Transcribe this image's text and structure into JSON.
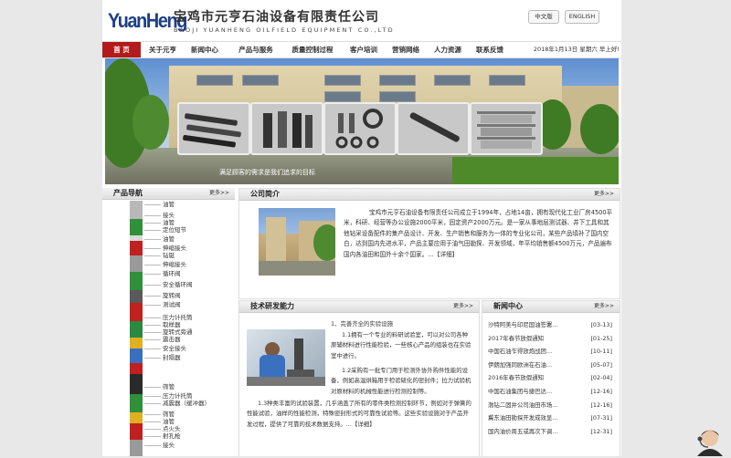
{
  "header": {
    "logo_en": "YuanHeng",
    "company_cn": "宝鸡市元亨石油设备有限责任公司",
    "company_en": "BAOJI YUANHENG OILFIELD EQUIPMENT CO.,LTD",
    "lang_cn": "中文版",
    "lang_en": "ENGLISH"
  },
  "nav": {
    "items": [
      "首 页",
      "关于元亨",
      "新闻中心",
      "产品与服务",
      "质量控制过程",
      "客户培训",
      "营销网络",
      "人力资源",
      "联系反馈"
    ],
    "date": "2018年1月13日 星期六 早上好!"
  },
  "banner": {
    "caption": "满足顾客的需求是我们追求的目标"
  },
  "products": {
    "title": "产品导航",
    "more": "更多>>",
    "items": [
      "油管",
      "接头",
      "油管",
      "定位短节",
      "油管",
      "伸缩接头",
      "钻铤",
      "伸缩接头",
      "循环阀",
      "安全循环阀",
      "旋转阀",
      "测试阀",
      "压力计托筒",
      "取样器",
      "旋转式旁通",
      "震击器",
      "安全接头",
      "封隔器",
      "筛管",
      "压力计托筒",
      "减震器（缓冲器）",
      "筛管",
      "油管",
      "点火头",
      "射孔枪",
      "接头"
    ]
  },
  "company": {
    "title": "公司简介",
    "more": "更多>>",
    "text": "宝鸡市元亨石油设备有限责任公司成立于1994年，占地14亩，拥有现代化工业厂房4500平米，科研、经营等办公设施2000平米，固定资产2000万元。是一家从事地层测试器、井下工具和其他钻采设备配件的集产品设计、开发、生产销售和服务为一体的专业化公司，某些产品填补了国内空白，达到国内先进水平，产品主要应用于油气田勘探、开发领域，年平均销售额4500万元，产品遍布国内各油田和国外十余个国家。…【详细】"
  },
  "tech": {
    "title": "技术研发能力",
    "more": "更多>>",
    "p1": "1、完善齐全的实验设施",
    "p2": "1.1拥有一个专业的料研试验室，可以对公司各种原辅材料进行性能检验，一些核心产品的组装也在实验室中进行。",
    "p3": "1.2采购有一批专门用于检测外协外购件性能的设备，例如高温烘箱用于检验硫化的密封件；拉力试验机对原材料的机械性能进行检测控制等。",
    "p4": "1.3种类丰富的试验装置，几乎涵盖了所有的零件类检测控制环节，例如对于弹簧的性能试验，油样的性能检测，特殊密封形式的可靠性试验等。这些实验设施对于产品开发过程，提供了可靠的技术数据支持。…【详细】"
  },
  "news": {
    "title": "新闻中心",
    "more": "更多>>",
    "items": [
      {
        "title": "沙特阿美与印尼国油签署…",
        "date": "[03-13]"
      },
      {
        "title": "2017年春节放假通知",
        "date": "[01-25]"
      },
      {
        "title": "中国石油乍得放炮战团…",
        "date": "[10-11]"
      },
      {
        "title": "伊朗加强同欧洲在石油…",
        "date": "[05-07]"
      },
      {
        "title": "2016年春节放假通知",
        "date": "[02-04]"
      },
      {
        "title": "中国石油集团与捷巴达…",
        "date": "[12-16]"
      },
      {
        "title": "渤钻二固井公司油田市场…",
        "date": "[12-16]"
      },
      {
        "title": "冀东油田勘探开发成效显…",
        "date": "[07-31]"
      },
      {
        "title": "国内油价周五或再次下调…",
        "date": "[12-31]"
      }
    ]
  }
}
